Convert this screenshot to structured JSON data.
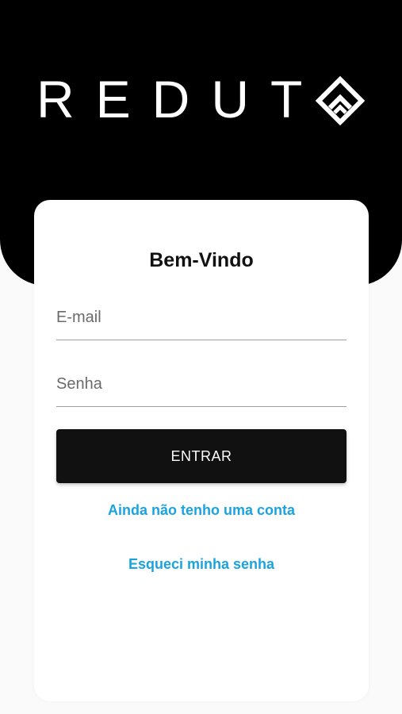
{
  "brand": {
    "logo_text": "REDUT",
    "logo_icon": "diamond-logo-icon"
  },
  "login": {
    "title": "Bem-Vindo",
    "email_placeholder": "E-mail",
    "email_value": "",
    "password_placeholder": "Senha",
    "password_value": "",
    "submit_label": "ENTRAR",
    "signup_link": "Ainda não tenho uma conta",
    "forgot_link": "Esqueci minha senha"
  },
  "colors": {
    "header_bg": "#000000",
    "button_bg": "#111111",
    "link": "#1aa3e0",
    "page_bg": "#fafafa"
  }
}
